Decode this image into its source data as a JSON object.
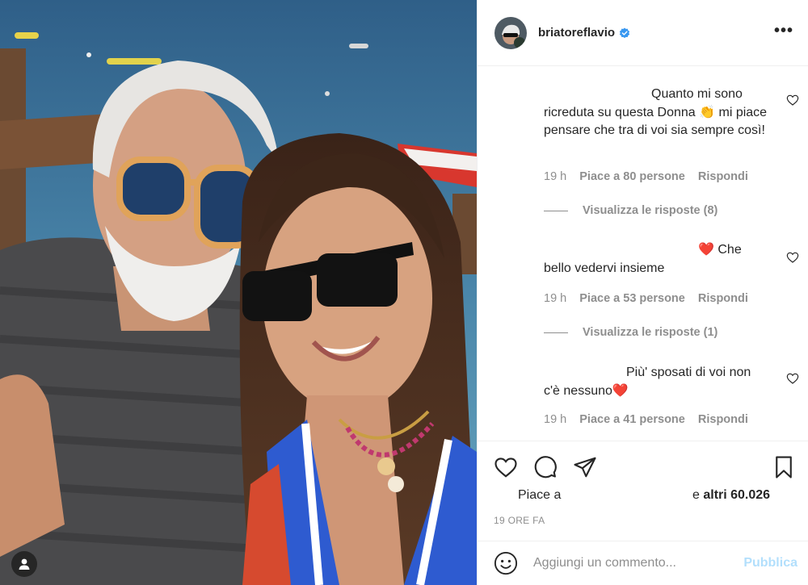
{
  "post": {
    "username": "briatoreflavio",
    "verified": true,
    "more_label": "•••"
  },
  "comments": [
    {
      "text": "Quanto mi sono ricreduta su questa Donna 👏 mi piace pensare che tra di voi sia sempre così!",
      "time": "19 h",
      "likes": "Piace a 80 persone",
      "reply": "Rispondi",
      "view_replies": "Visualizza le risposte (8)"
    },
    {
      "text": "❤️ Che bello vedervi insieme",
      "time": "19 h",
      "likes": "Piace a 53 persone",
      "reply": "Rispondi",
      "view_replies": "Visualizza le risposte (1)"
    },
    {
      "text": "Più' sposati di voi non c'è nessuno❤️",
      "time": "19 h",
      "likes": "Piace a 41 persone",
      "reply": "Rispondi"
    }
  ],
  "likes_summary": {
    "prefix": "Piace a",
    "suffix_normal": "e ",
    "suffix_bold": "altri 60.026"
  },
  "timestamp": "19 ORE FA",
  "comment_box": {
    "placeholder": "Aggiungi un commento...",
    "publish_label": "Pubblica"
  },
  "icons": {
    "like": "heart-icon",
    "comment": "comment-bubble-icon",
    "share": "paper-plane-icon",
    "save": "bookmark-icon",
    "emoji": "smiley-icon",
    "tag": "user-tag-icon"
  },
  "colors": {
    "text": "#262626",
    "muted": "#8e8e8e",
    "border": "#efefef",
    "publish_disabled": "#b2dffc",
    "verified": "#3897f0"
  }
}
